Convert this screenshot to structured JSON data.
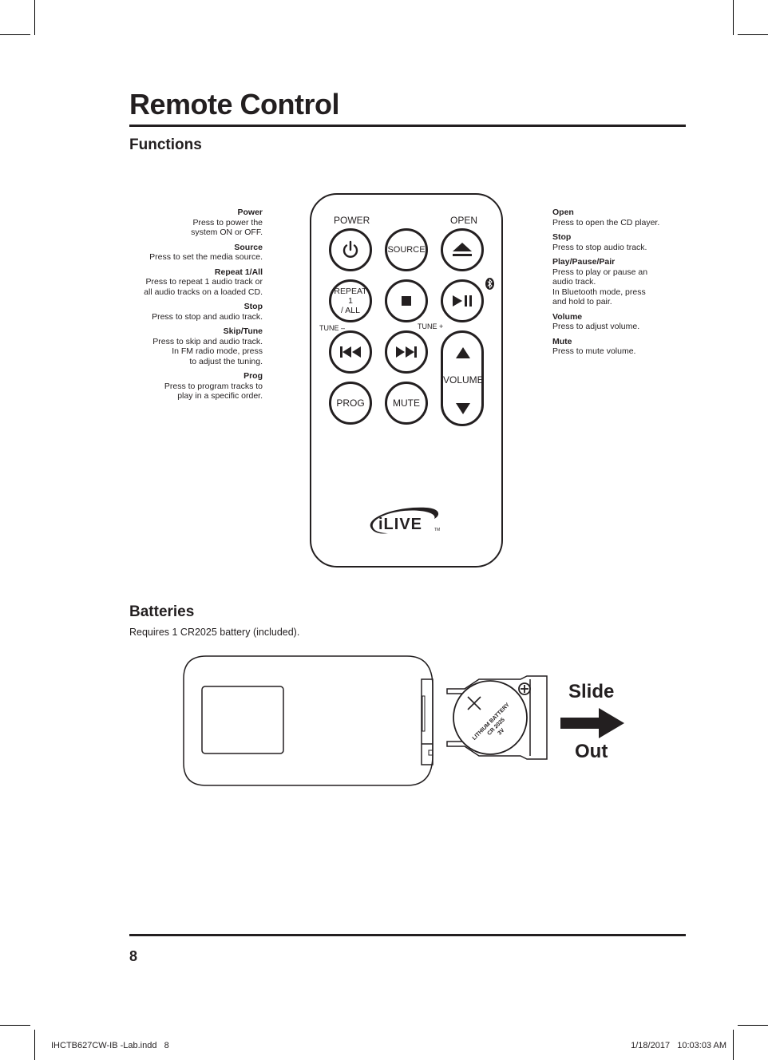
{
  "page": {
    "title": "Remote Control",
    "page_number": "8"
  },
  "functions": {
    "heading": "Functions",
    "left": [
      {
        "name": "Power",
        "desc": [
          "Press to power the",
          "system ON or OFF."
        ]
      },
      {
        "name": "Source",
        "desc": [
          "Press to set the media source."
        ]
      },
      {
        "name": "Repeat 1/All",
        "desc": [
          "Press to repeat 1 audio track or",
          "all audio tracks on a loaded CD."
        ]
      },
      {
        "name": "Stop",
        "desc": [
          "Press to stop and audio track."
        ]
      },
      {
        "name": "Skip/Tune",
        "desc": [
          "Press to skip and audio track.",
          "In FM radio mode, press",
          "to adjust the tuning."
        ]
      },
      {
        "name": "Prog",
        "desc": [
          "Press to program tracks to",
          "play in a specific order."
        ]
      }
    ],
    "right": [
      {
        "name": "Open",
        "desc": [
          "Press to open the CD player."
        ]
      },
      {
        "name": "Stop",
        "desc": [
          "Press to stop audio track."
        ]
      },
      {
        "name": "Play/Pause/Pair",
        "desc": [
          "Press to play or pause an",
          "audio track.",
          "In Bluetooth mode, press",
          "and hold to pair."
        ]
      },
      {
        "name": "Volume",
        "desc": [
          "Press to adjust volume."
        ]
      },
      {
        "name": "Mute",
        "desc": [
          "Press to mute volume."
        ]
      }
    ]
  },
  "remote": {
    "labels": {
      "power": "POWER",
      "open": "OPEN",
      "tune_minus": "TUNE –",
      "tune_plus": "TUNE +"
    },
    "buttons": {
      "source": "SOURCE",
      "repeat_line1": "REPEAT 1",
      "repeat_line2": "/ ALL",
      "prog": "PROG",
      "mute": "MUTE",
      "volume": "VOLUME"
    },
    "icons": {
      "power": "power-icon",
      "eject": "eject-icon",
      "stop": "stop-icon",
      "play_pause": "play-pause-icon",
      "bluetooth": "bluetooth-icon",
      "prev": "skip-back-icon",
      "next": "skip-forward-icon",
      "vol_up": "triangle-up-icon",
      "vol_down": "triangle-down-icon"
    },
    "logo": "iLIVE",
    "logo_tm": "TM"
  },
  "batteries": {
    "heading": "Batteries",
    "text": "Requires 1 CR2025 battery (included).",
    "battery_text": [
      "LITHIUM BATTERY",
      "CR 2025",
      "3V"
    ],
    "slide_label": "Slide",
    "out_label": "Out"
  },
  "slug": {
    "filename": "IHCTB627CW-IB -Lab.indd   8",
    "timestamp": "1/18/2017   10:03:03 AM"
  }
}
